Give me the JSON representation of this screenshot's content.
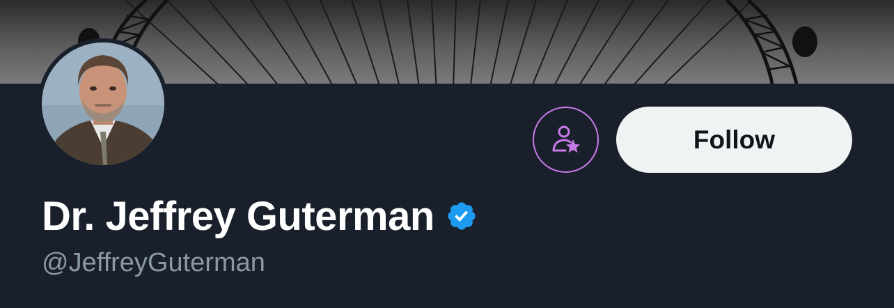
{
  "profile": {
    "display_name": "Dr. Jeffrey Guterman",
    "handle": "@JeffreyGuterman",
    "verified": true
  },
  "actions": {
    "follow_label": "Follow",
    "subscribe_icon": "person-star-icon"
  },
  "icons": {
    "verified_badge": "verified-badge-icon",
    "avatar": "avatar-photo"
  },
  "colors": {
    "background": "#19202b",
    "name_text": "#ffffff",
    "handle_text": "#8b98a5",
    "follow_bg": "#eff3f4",
    "follow_text": "#0f1419",
    "verified_blue": "#1d9bf0",
    "subscribe_accent": "#c87be8"
  }
}
